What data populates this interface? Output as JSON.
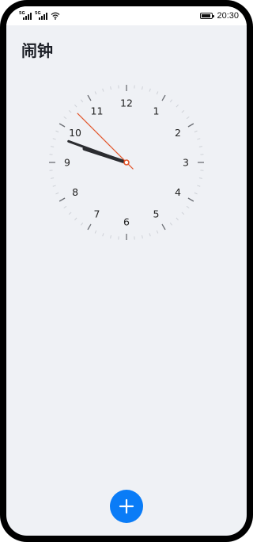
{
  "status_bar": {
    "sim1_label": "5G",
    "sim2_label": "5G",
    "time": "20:30",
    "battery_level": 0.85,
    "icons": [
      "signal-icon",
      "signal-icon",
      "wifi-icon",
      "battery-icon"
    ]
  },
  "page": {
    "title": "闹钟"
  },
  "clock": {
    "numerals": [
      "12",
      "1",
      "2",
      "3",
      "4",
      "5",
      "6",
      "7",
      "8",
      "9",
      "10",
      "11"
    ],
    "hour_angle_deg": 288,
    "minute_angle_deg": 290,
    "second_angle_deg": 315,
    "colors": {
      "numerals": "#222222",
      "ticks_minor": "#cfd2d8",
      "ticks_major": "#6b6e74",
      "hands": "#2b2c30",
      "second_hand": "#e2552b"
    }
  },
  "fab": {
    "icon": "plus-icon",
    "color": "#0a7cf7"
  }
}
